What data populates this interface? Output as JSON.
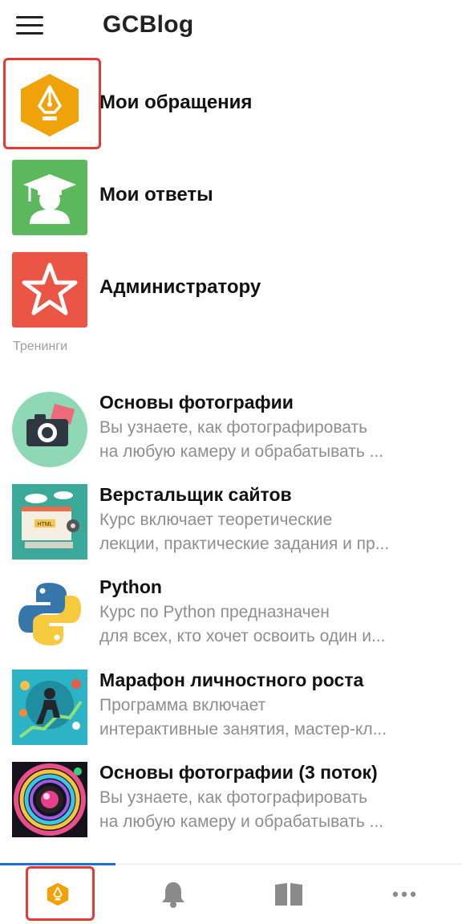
{
  "header": {
    "title": "GCBlog",
    "menu_icon": "hamburger-icon"
  },
  "menu": [
    {
      "label": "Мои обращения",
      "icon": "pen-nib-icon",
      "color": "#f0a20a"
    },
    {
      "label": "Мои ответы",
      "icon": "graduate-icon",
      "color": "#5cb85c"
    },
    {
      "label": "Администратору",
      "icon": "star-icon",
      "color": "#ea5546"
    }
  ],
  "section": {
    "label": "Тренинги"
  },
  "courses": [
    {
      "title": "Основы фотографии",
      "desc1": "Вы узнаете, как фотографировать",
      "desc2": "на любую камеру и обрабатывать ...",
      "thumb": "camera-thumbnail"
    },
    {
      "title": "Верстальщик сайтов",
      "desc1": "Курс включает теоретические",
      "desc2": "лекции, практические задания и пр...",
      "thumb": "webdev-thumbnail",
      "thumb_text": "HTML"
    },
    {
      "title": "Python",
      "desc1": "Курс по Python предназначен",
      "desc2": "для всех, кто хочет освоить один и...",
      "thumb": "python-logo-thumbnail"
    },
    {
      "title": "Марафон личностного роста",
      "desc1": "Программа включает",
      "desc2": "интерактивные занятия, мастер-кл...",
      "thumb": "growth-thumbnail"
    },
    {
      "title": "Основы фотографии (3 поток)",
      "desc1": "Вы узнаете, как фотографировать",
      "desc2": "на любую камеру и обрабатывать ...",
      "thumb": "lens-thumbnail"
    }
  ],
  "bottom_nav": [
    {
      "name": "nav-home",
      "icon": "pen-nib-icon",
      "active": true
    },
    {
      "name": "nav-notifications",
      "icon": "bell-icon"
    },
    {
      "name": "nav-library",
      "icon": "book-icon"
    },
    {
      "name": "nav-more",
      "icon": "more-icon"
    }
  ],
  "colors": {
    "accent": "#1e6fd9",
    "highlight": "#e53935",
    "secondary_text": "#8e8e8e"
  }
}
